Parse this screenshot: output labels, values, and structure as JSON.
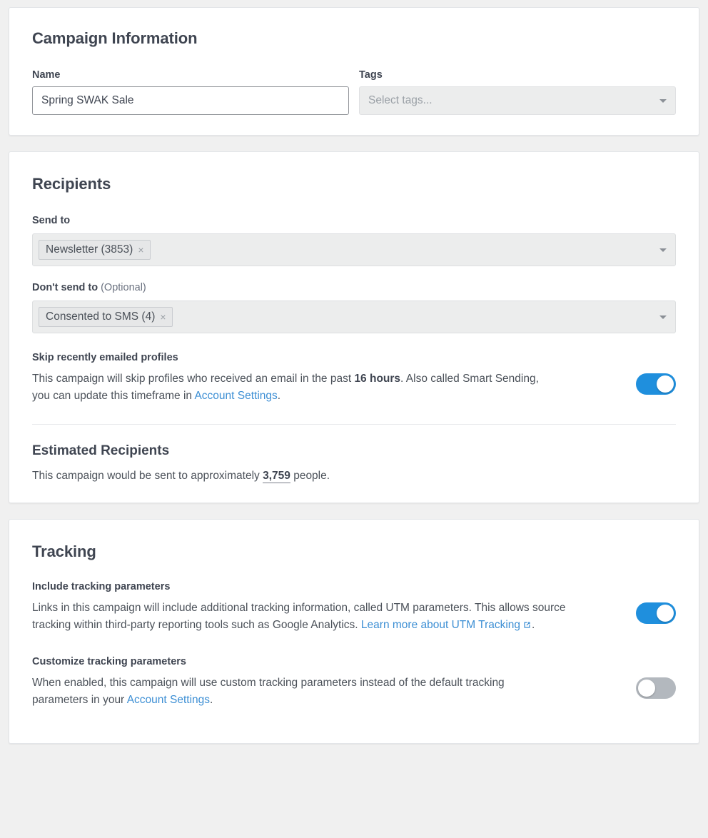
{
  "campaign_information": {
    "title": "Campaign Information",
    "name_label": "Name",
    "name_value": "Spring SWAK Sale",
    "tags_label": "Tags",
    "tags_placeholder": "Select tags..."
  },
  "recipients": {
    "title": "Recipients",
    "send_to_label": "Send to",
    "send_to_tokens": [
      {
        "label": "Newsletter (3853)",
        "remove": "×"
      }
    ],
    "dont_send_to_label": "Don't send to",
    "dont_send_to_optional": "(Optional)",
    "dont_send_to_tokens": [
      {
        "label": "Consented to SMS (4)",
        "remove": "×"
      }
    ],
    "skip_recent": {
      "label": "Skip recently emailed profiles",
      "text_part1": "This campaign will skip profiles who received an email in the past ",
      "timeframe": "16 hours",
      "text_part2": ". Also called Smart Sending, you can update this timeframe in ",
      "link": "Account Settings",
      "text_part3": ".",
      "toggle_state": "on"
    },
    "estimated": {
      "title": "Estimated Recipients",
      "text_part1": "This campaign would be sent to approximately ",
      "count": "3,759",
      "text_part2": " people."
    }
  },
  "tracking": {
    "title": "Tracking",
    "include": {
      "label": "Include tracking parameters",
      "text_part1": "Links in this campaign will include additional tracking information, called UTM parameters. This allows source tracking within third-party reporting tools such as Google Analytics. ",
      "link": "Learn more about UTM Tracking",
      "text_part2": ".",
      "toggle_state": "on"
    },
    "customize": {
      "label": "Customize tracking parameters",
      "text_part1": "When enabled, this campaign will use custom tracking parameters instead of the default tracking parameters in your ",
      "link": "Account Settings",
      "text_part2": ".",
      "toggle_state": "off"
    }
  },
  "colors": {
    "accent": "#1f8fdd",
    "link": "#3d8fd4",
    "toggle_off": "#b3b8be",
    "card_bg": "#ffffff",
    "page_bg": "#f0f0f0"
  }
}
